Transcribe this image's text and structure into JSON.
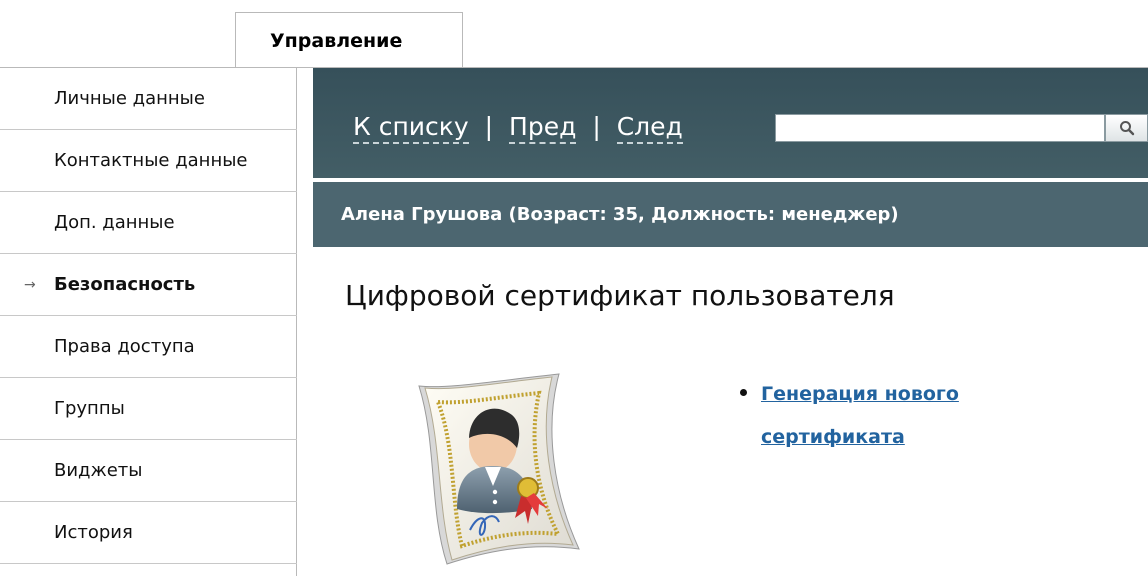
{
  "tabs": [
    {
      "label": "Управление"
    }
  ],
  "sidebar": {
    "items": [
      {
        "label": "Личные данные"
      },
      {
        "label": "Контактные данные"
      },
      {
        "label": "Доп. данные"
      },
      {
        "label": "Безопасность"
      },
      {
        "label": "Права доступа"
      },
      {
        "label": "Группы"
      },
      {
        "label": "Виджеты"
      },
      {
        "label": "История"
      }
    ],
    "active_marker": "→"
  },
  "nav": {
    "to_list": "К списку",
    "prev": "Пред",
    "next": "След",
    "separator": "|"
  },
  "search": {
    "value": "",
    "icon": "search-icon"
  },
  "person": {
    "summary": "Алена Грушова (Возраст: 35, Должность: менеджер)"
  },
  "main": {
    "title": "Цифровой сертификат пользователя",
    "links": [
      {
        "label": "Генерация нового сертификата"
      }
    ]
  },
  "colors": {
    "header": "#3f5962",
    "info": "#4c6670",
    "link": "#22639f"
  }
}
